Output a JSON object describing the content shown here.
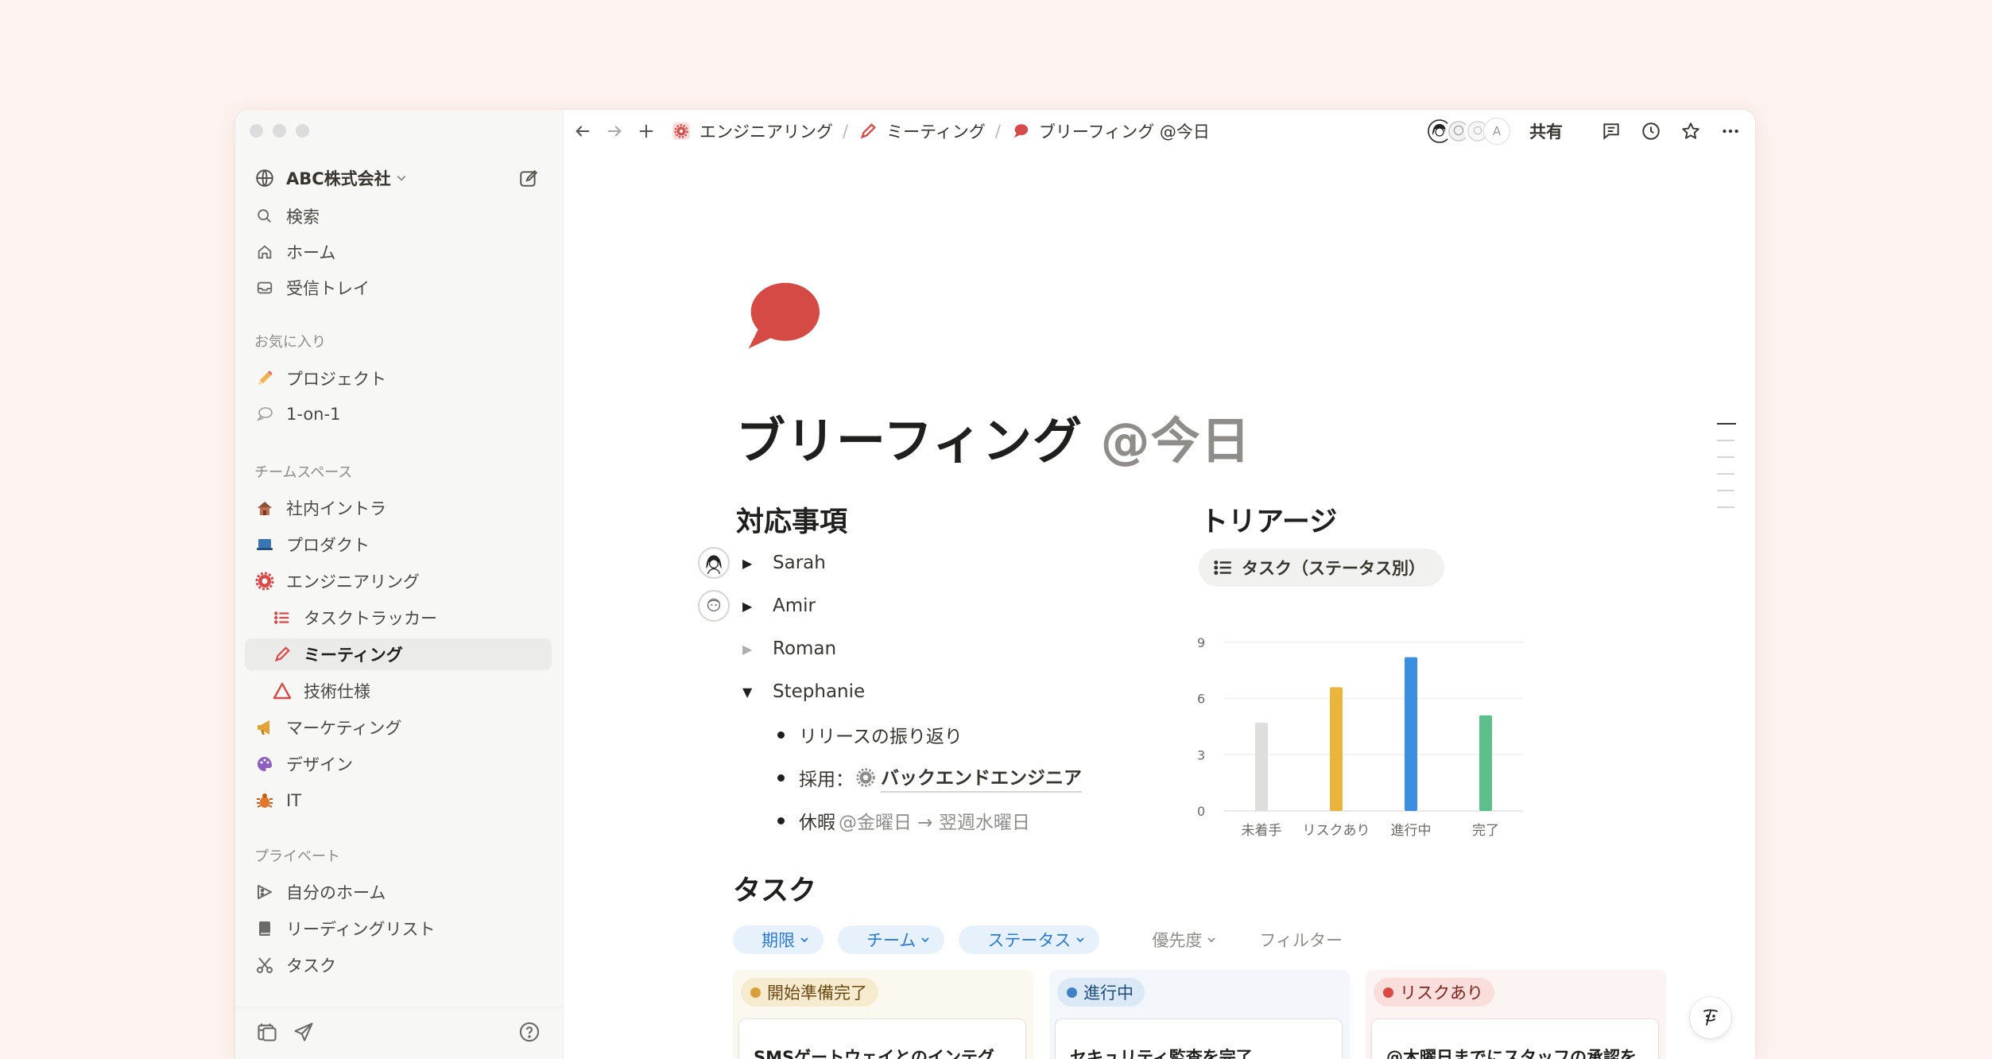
{
  "sidebar": {
    "workspace": "ABC株式会社",
    "top_items": [
      {
        "label": "検索",
        "icon": "search-icon"
      },
      {
        "label": "ホーム",
        "icon": "home-icon"
      },
      {
        "label": "受信トレイ",
        "icon": "inbox-icon"
      }
    ],
    "favorites_label": "お気に入り",
    "favorites": [
      {
        "label": "プロジェクト",
        "icon": "pencil-icon"
      },
      {
        "label": "1-on-1",
        "icon": "speech-bubble-icon"
      }
    ],
    "teamspace_label": "チームスペース",
    "teamspace": [
      {
        "label": "社内イントラ",
        "icon": "house-icon"
      },
      {
        "label": "プロダクト",
        "icon": "laptop-icon"
      },
      {
        "label": "エンジニアリング",
        "icon": "gear-icon"
      },
      {
        "label": "タスクトラッカー",
        "icon": "list-icon"
      },
      {
        "label": "ミーティング",
        "icon": "pencil-icon"
      },
      {
        "label": "技術仕様",
        "icon": "triangle-icon"
      },
      {
        "label": "マーケティング",
        "icon": "megaphone-icon"
      },
      {
        "label": "デザイン",
        "icon": "palette-icon"
      },
      {
        "label": "IT",
        "icon": "bug-icon"
      }
    ],
    "private_label": "プライベート",
    "private": [
      {
        "label": "自分のホーム",
        "icon": "pizza-icon"
      },
      {
        "label": "リーディングリスト",
        "icon": "book-icon"
      },
      {
        "label": "タスク",
        "icon": "scissors-icon"
      }
    ]
  },
  "topbar": {
    "breadcrumbs": [
      {
        "label": "エンジニアリング",
        "icon": "gear-icon"
      },
      {
        "label": "ミーティング",
        "icon": "pencil-icon"
      },
      {
        "label": "ブリーフィング @今日",
        "icon": "speech-bubble-icon"
      }
    ],
    "avatar_initial": "A",
    "share_label": "共有"
  },
  "page": {
    "title": "ブリーフィング",
    "title_mention": "@今日",
    "actions_heading": "対応事項",
    "toggles": [
      "Sarah",
      "Amir",
      "Roman",
      "Stephanie"
    ],
    "bullets": {
      "b1": "リリースの振り返り",
      "b2_prefix": "採用：",
      "b2_link": "バックエンドエンジニア",
      "b3_prefix": "休暇",
      "b3_mention": "@金曜日 → 翌週水曜日"
    },
    "triage_heading": "トリアージ",
    "triage_view": "タスク（ステータス別）",
    "tasks_heading": "タスク",
    "filters": [
      "期限",
      "チーム",
      "ステータス"
    ],
    "filters_plain": [
      "優先度",
      "フィルター"
    ],
    "board": [
      {
        "status": "開始準備完了",
        "dot": "#d9a03a",
        "tag_bg": "#f6ebcf",
        "tag_color": "#6b4b13",
        "col_bg": "#fbf8ef",
        "card": "SMSゲートウェイとのインテグ"
      },
      {
        "status": "進行中",
        "dot": "#3f82c4",
        "tag_bg": "#dbe9f6",
        "tag_color": "#1e4d7d",
        "col_bg": "#f3f7fb",
        "card": "セキュリティ監査を完了"
      },
      {
        "status": "リスクあり",
        "dot": "#d94a44",
        "tag_bg": "#f9dedc",
        "tag_color": "#7d2420",
        "col_bg": "#fcf4f3",
        "card": "@木曜日までにスタッフの承認を"
      }
    ]
  },
  "chart_data": {
    "type": "bar",
    "categories": [
      "未着手",
      "リスクあり",
      "進行中",
      "完了"
    ],
    "values": [
      4.7,
      6.6,
      8.2,
      5.1
    ],
    "colors": [
      "#dededc",
      "#e9b53c",
      "#3b8fe1",
      "#5cbf8c"
    ],
    "yticks": [
      0,
      3,
      6,
      9
    ],
    "ylim": [
      0,
      9.5
    ],
    "grid": true
  },
  "colors": {
    "page_bg": "#fdf2ef",
    "accent_blue": "#2a7ad1",
    "brand_red": "#d94a44"
  }
}
